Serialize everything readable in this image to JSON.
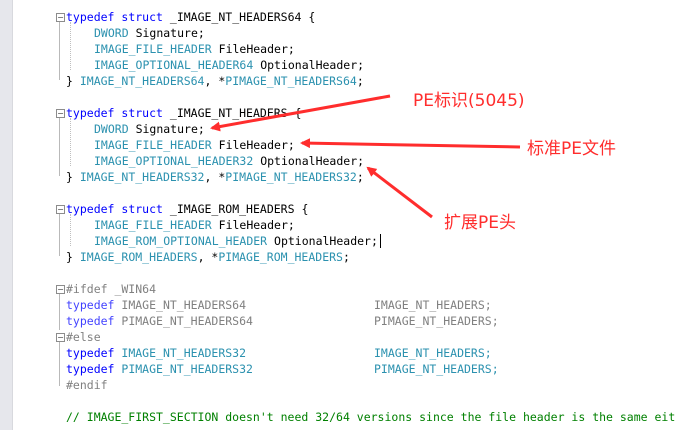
{
  "code": {
    "block64": {
      "open": {
        "kw": "typedef",
        "kw2": "struct",
        "name": "_IMAGE_NT_HEADERS64 {"
      },
      "f1": {
        "type": "DWORD",
        "name": "Signature;"
      },
      "f2": {
        "type": "IMAGE_FILE_HEADER",
        "name": "FileHeader;"
      },
      "f3": {
        "type": "IMAGE_OPTIONAL_HEADER64",
        "name": "OptionalHeader;"
      },
      "close": {
        "pre": "} ",
        "type1": "IMAGE_NT_HEADERS64",
        "mid": ", *",
        "type2": "PIMAGE_NT_HEADERS64",
        "end": ";"
      }
    },
    "block32": {
      "open": {
        "kw": "typedef",
        "kw2": "struct",
        "name": "_IMAGE_NT_HEADERS {"
      },
      "f1": {
        "type": "DWORD",
        "name": "Signature;"
      },
      "f2": {
        "type": "IMAGE_FILE_HEADER",
        "name": "FileHeader;"
      },
      "f3": {
        "type": "IMAGE_OPTIONAL_HEADER32",
        "name": "OptionalHeader;"
      },
      "close": {
        "pre": "} ",
        "type1": "IMAGE_NT_HEADERS32",
        "mid": ", *",
        "type2": "PIMAGE_NT_HEADERS32",
        "end": ";"
      }
    },
    "blockrom": {
      "open": {
        "kw": "typedef",
        "kw2": "struct",
        "name": "_IMAGE_ROM_HEADERS {"
      },
      "f1": {
        "type": "IMAGE_FILE_HEADER",
        "name": "FileHeader;"
      },
      "f2": {
        "type": "IMAGE_ROM_OPTIONAL_HEADER",
        "name": "OptionalHeader;"
      },
      "close": {
        "pre": "} ",
        "type1": "IMAGE_ROM_HEADERS",
        "mid": ", *",
        "type2": "PIMAGE_ROM_HEADERS",
        "end": ";"
      }
    },
    "ifdef": "#ifdef _WIN64",
    "td1": {
      "kw": "typedef",
      "a": "IMAGE_NT_HEADERS64",
      "b": "IMAGE_NT_HEADERS;"
    },
    "td2": {
      "kw": "typedef",
      "a": "PIMAGE_NT_HEADERS64",
      "b": "PIMAGE_NT_HEADERS;"
    },
    "else": "#else",
    "td3": {
      "kw": "typedef",
      "a": "IMAGE_NT_HEADERS32",
      "b": "IMAGE_NT_HEADERS;"
    },
    "td4": {
      "kw": "typedef",
      "a": "PIMAGE_NT_HEADERS32",
      "b": "PIMAGE_NT_HEADERS;"
    },
    "endif": "#endif",
    "comment": "// IMAGE_FIRST_SECTION doesn't need 32/64 versions since the file header is the same eit"
  },
  "annotations": {
    "pe_sig": "PE标识(5045)",
    "std_pe": "标准PE文件",
    "ext_pe": "扩展PE头"
  },
  "colors": {
    "keyword": "#0000ff",
    "type": "#2b91af",
    "comment": "#008000",
    "preprocessor": "#808080",
    "annotation": "#ff2d2d"
  }
}
